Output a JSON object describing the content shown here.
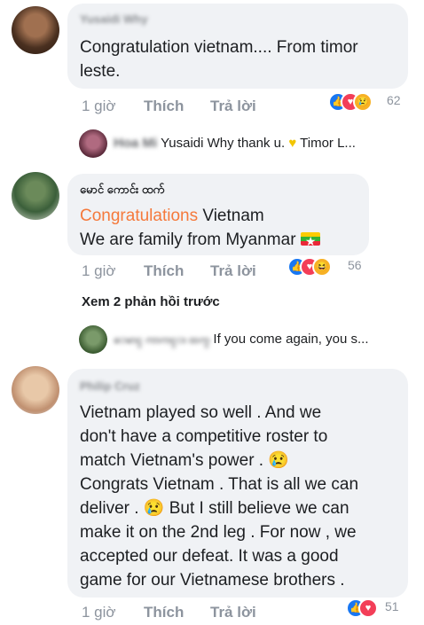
{
  "comments": [
    {
      "author": "Yusaidi Why",
      "text_lines": [
        "Congratulation vietnam.... From timor",
        "leste."
      ],
      "time": "1 giờ",
      "like_label": "Thích",
      "reply_label": "Trả lời",
      "reactions": [
        "like",
        "love",
        "sad"
      ],
      "reaction_count": "62"
    },
    {
      "author": "မောင် ကောင်း ထက်",
      "text_highlight": "Congratulations",
      "text_rest_line1": " Vietnam",
      "text_line2": "We are family from Myanmar",
      "time": "1 giờ",
      "like_label": "Thích",
      "reply_label": "Trả lời",
      "reactions": [
        "like",
        "love",
        "haha"
      ],
      "reaction_count": "56"
    },
    {
      "author": "Philip Cruz",
      "text_lines": [
        "Vietnam played so well . And we",
        "don't have a competitive roster to",
        "match Vietnam's power .",
        "Congrats Vietnam . That is all we can",
        "deliver .",
        "make it on the 2nd leg . For now , we",
        "accepted our defeat.  It was a good",
        "game for our Vietnamese brothers ."
      ],
      "line5_rest": " But I still believe we can",
      "time": "1 giờ",
      "like_label": "Thích",
      "reply_label": "Trả lời",
      "reactions": [
        "like",
        "love"
      ],
      "reaction_count": "51"
    }
  ],
  "replies": [
    {
      "author": "Hoa Mi",
      "text": "Yusaidi Why thank u.",
      "text_after": "Timor L..."
    },
    {
      "author": "ေမာင္ ကာကင္း ထက္",
      "text": "If you come again, you s..."
    }
  ],
  "view_previous": "Xem 2 phản hồi trước",
  "colors": {
    "bubble": "#f0f2f5",
    "highlight": "#f5793b",
    "muted": "#8d949e",
    "like": "#1877f2",
    "love": "#f33e58"
  }
}
